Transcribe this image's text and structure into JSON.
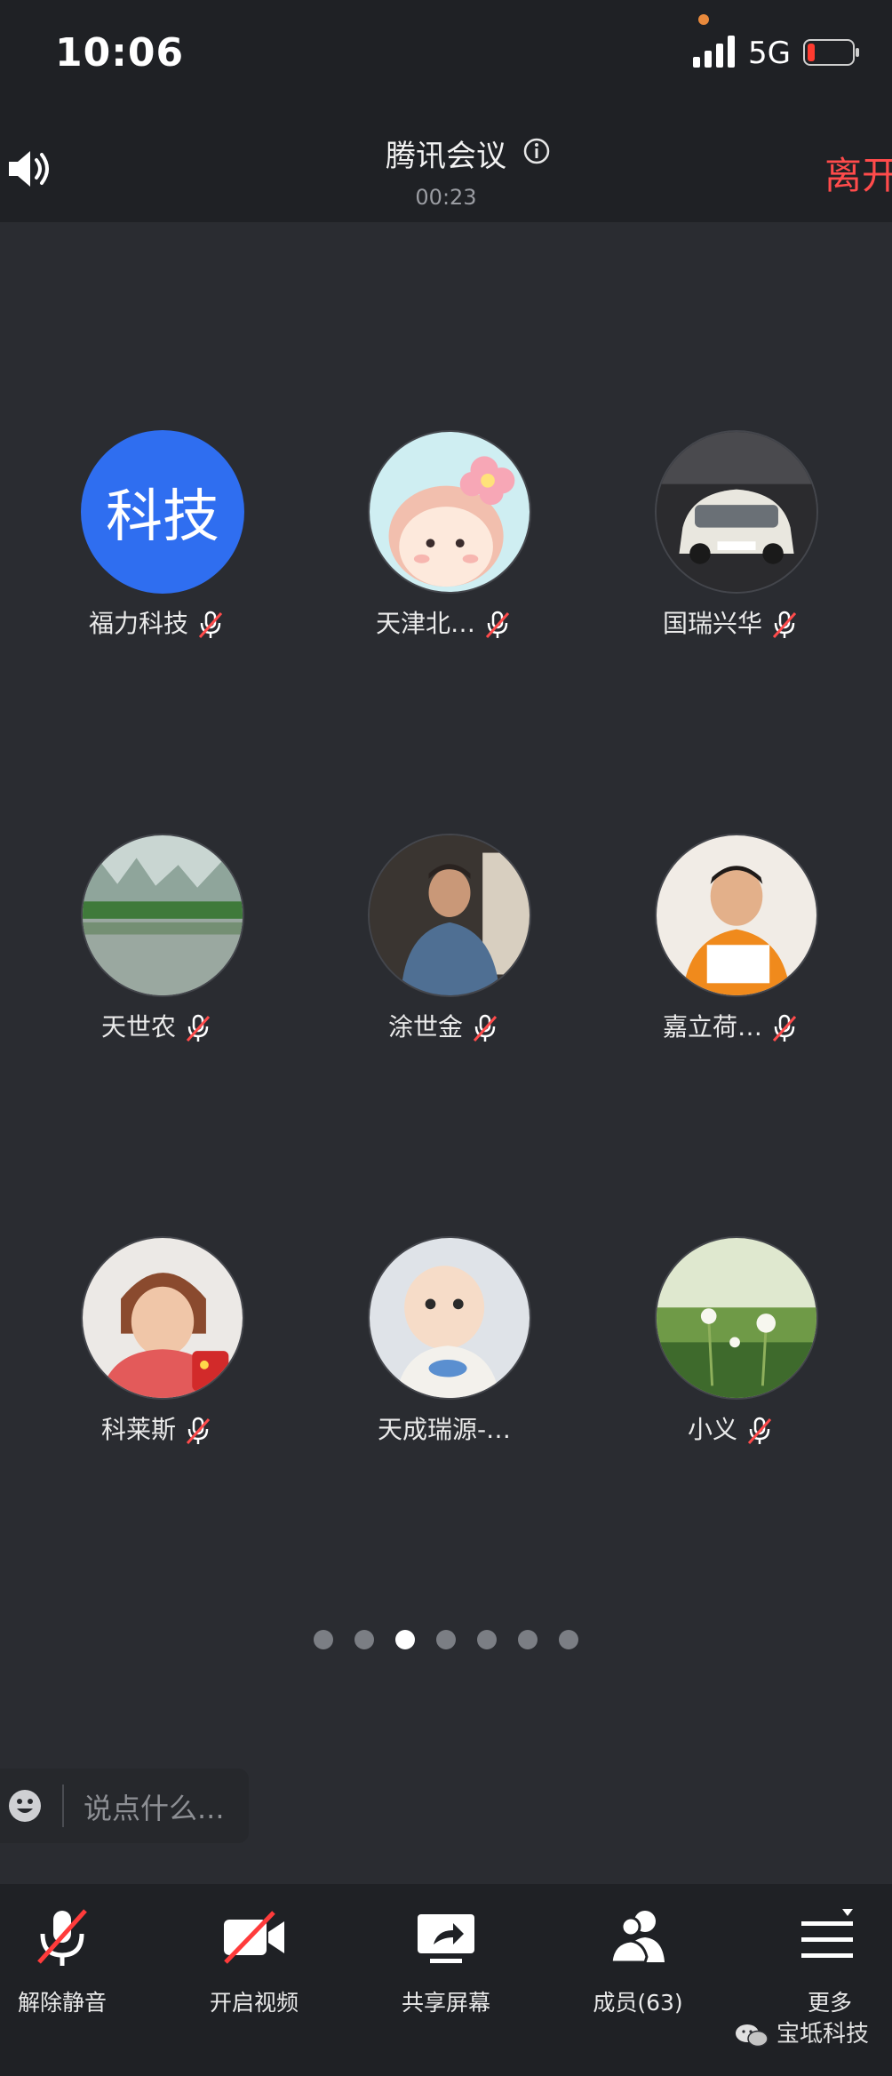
{
  "status_bar": {
    "time": "10:06",
    "network": "5G"
  },
  "header": {
    "title": "腾讯会议",
    "timer": "00:23",
    "leave_label": "离开"
  },
  "participants": [
    {
      "name": "福力科技",
      "avatar_text": "科技",
      "avatar_type": "text",
      "muted": true
    },
    {
      "name": "天津北…",
      "avatar_type": "cartoon-girl",
      "muted": true
    },
    {
      "name": "国瑞兴华",
      "avatar_type": "car",
      "muted": true
    },
    {
      "name": "天世农",
      "avatar_type": "landscape",
      "muted": true
    },
    {
      "name": "涂世金",
      "avatar_type": "man",
      "muted": true
    },
    {
      "name": "嘉立荷…",
      "avatar_type": "child",
      "muted": true
    },
    {
      "name": "科莱斯",
      "avatar_type": "woman",
      "muted": true
    },
    {
      "name": "天成瑞源-…",
      "avatar_type": "baby",
      "muted": false
    },
    {
      "name": "小义",
      "avatar_type": "dandelion",
      "muted": true
    }
  ],
  "pagination": {
    "total": 7,
    "current": 3
  },
  "chat": {
    "placeholder": "说点什么..."
  },
  "toolbar": {
    "unmute_label": "解除静音",
    "video_label": "开启视频",
    "share_label": "共享屏幕",
    "members_label": "成员(63)",
    "more_label": "更多"
  },
  "watermark": {
    "text": "宝坻科技"
  },
  "colors": {
    "accent_blue": "#2f6ef0",
    "leave_red": "#ff4b4b",
    "background": "#2a2c31",
    "bar": "#1f2125"
  }
}
